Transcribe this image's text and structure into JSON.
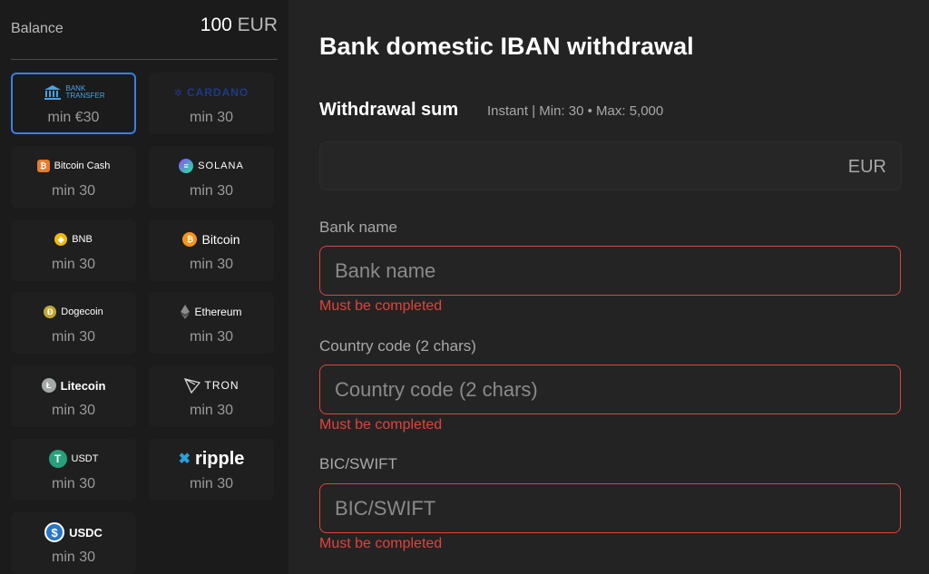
{
  "balance": {
    "label": "Balance",
    "amount": "100",
    "currency": "EUR"
  },
  "methods": [
    {
      "name": "BANK TRANSFER",
      "min": "min €30",
      "icon": "bank-icon",
      "selected": true
    },
    {
      "name": "CARDANO",
      "min": "min 30",
      "icon": "cardano-icon"
    },
    {
      "name": "Bitcoin Cash",
      "min": "min 30",
      "icon": "bitcoin-cash-icon"
    },
    {
      "name": "SOLANA",
      "min": "min 30",
      "icon": "solana-icon"
    },
    {
      "name": "BNB",
      "min": "min 30",
      "icon": "bnb-icon"
    },
    {
      "name": "Bitcoin",
      "min": "min 30",
      "icon": "bitcoin-icon"
    },
    {
      "name": "Dogecoin",
      "min": "min 30",
      "icon": "dogecoin-icon"
    },
    {
      "name": "Ethereum",
      "min": "min 30",
      "icon": "ethereum-icon"
    },
    {
      "name": "Litecoin",
      "min": "min 30",
      "icon": "litecoin-icon"
    },
    {
      "name": "TRON",
      "min": "min 30",
      "icon": "tron-icon"
    },
    {
      "name": "USDT",
      "min": "min 30",
      "icon": "usdt-icon"
    },
    {
      "name": "ripple",
      "min": "min 30",
      "icon": "ripple-icon"
    },
    {
      "name": "USDC",
      "min": "min 30",
      "icon": "usdc-icon"
    }
  ],
  "main": {
    "title": "Bank domestic IBAN withdrawal",
    "sum_title": "Withdrawal sum",
    "sum_info": "Instant | Min: 30 • Max: 5,000",
    "sum_currency": "EUR",
    "fields": [
      {
        "label": "Bank name",
        "placeholder": "Bank name",
        "error": "Must be completed"
      },
      {
        "label": "Country code (2 chars)",
        "placeholder": "Country code (2 chars)",
        "error": "Must be completed"
      },
      {
        "label": "BIC/SWIFT",
        "placeholder": "BIC/SWIFT",
        "error": "Must be completed"
      }
    ]
  },
  "colors": {
    "accent": "#3d7de3",
    "error": "#e0433c",
    "background": "#232323",
    "sidebar": "#1b1b1b"
  }
}
